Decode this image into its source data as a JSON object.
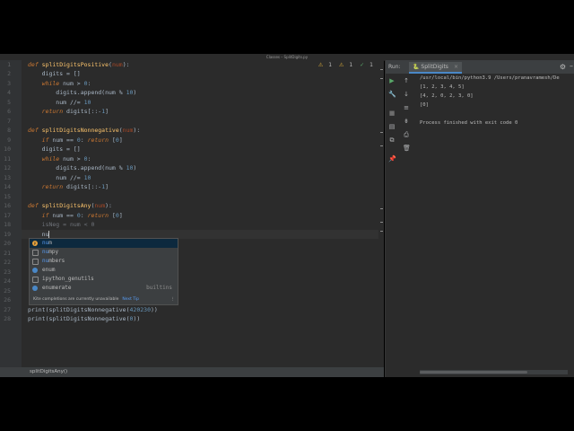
{
  "window": {
    "title": "Classes – SplitDigits.py"
  },
  "editor": {
    "inspections": {
      "warnings": "1",
      "weak_warnings": "1",
      "ok": "1"
    },
    "lines": [
      {
        "n": "1"
      },
      {
        "n": "2"
      },
      {
        "n": "3"
      },
      {
        "n": "4"
      },
      {
        "n": "5"
      },
      {
        "n": "6"
      },
      {
        "n": "7"
      },
      {
        "n": "8"
      },
      {
        "n": "9"
      },
      {
        "n": "10"
      },
      {
        "n": "11"
      },
      {
        "n": "12"
      },
      {
        "n": "13"
      },
      {
        "n": "14"
      },
      {
        "n": "15"
      },
      {
        "n": "16"
      },
      {
        "n": "17"
      },
      {
        "n": "18"
      },
      {
        "n": "19"
      },
      {
        "n": "20"
      },
      {
        "n": "21"
      },
      {
        "n": "22"
      },
      {
        "n": "23"
      },
      {
        "n": "24"
      },
      {
        "n": "25"
      },
      {
        "n": "26"
      },
      {
        "n": "27"
      },
      {
        "n": "28"
      }
    ],
    "code": {
      "l1_def": "def ",
      "l1_fn": "splitDigitsPositive",
      "l1_p1": "(",
      "l1_param": "num",
      "l1_p2": "):",
      "l2": "    digits = []",
      "l3_kw": "    while ",
      "l3_a": "num > ",
      "l3_num": "0",
      "l3_b": ":",
      "l4_a": "        digits.append(num % ",
      "l4_num": "10",
      "l4_b": ")",
      "l5_a": "        num //= ",
      "l5_num": "10",
      "l6_kw": "    return ",
      "l6_a": "digits[::-",
      "l6_num": "1",
      "l6_b": "]",
      "l8_def": "def ",
      "l8_fn": "splitDigitsNonnegative",
      "l8_p1": "(",
      "l8_param": "num",
      "l8_p2": "):",
      "l9_kw": "    if ",
      "l9_a": "num == ",
      "l9_num": "0",
      "l9_b": ": ",
      "l9_kw2": "return ",
      "l9_c": "[",
      "l9_num2": "0",
      "l9_d": "]",
      "l10": "    digits = []",
      "l11_kw": "    while ",
      "l11_a": "num > ",
      "l11_num": "0",
      "l11_b": ":",
      "l12_a": "        digits.append(num % ",
      "l12_num": "10",
      "l12_b": ")",
      "l13_a": "        num //= ",
      "l13_num": "10",
      "l14_kw": "    return ",
      "l14_a": "digits[::-",
      "l14_num": "1",
      "l14_b": "]",
      "l16_def": "def ",
      "l16_fn": "splitDigitsAny",
      "l16_p1": "(",
      "l16_param": "num",
      "l16_p2": "):",
      "l17_kw": "    if ",
      "l17_a": "num == ",
      "l17_num": "0",
      "l17_b": ": ",
      "l17_kw2": "return ",
      "l17_c": "[",
      "l17_num2": "0",
      "l17_d": "]",
      "l18_a": "    isNeg = num < ",
      "l18_num": "0",
      "l19": "    nu",
      "l27_a": "print(splitDigitsNonnegative(",
      "l27_num": "420230",
      "l27_b": "))",
      "l28_a": "print(splitDigitsNonnegative(",
      "l28_num": "0",
      "l28_b": "))"
    }
  },
  "completion": {
    "items": [
      {
        "match": "nu",
        "rest": "m",
        "icon": "p",
        "right": ""
      },
      {
        "match": "nu",
        "rest": "mpy",
        "icon": "",
        "right": ""
      },
      {
        "match": "nu",
        "rest": "mbers",
        "icon": "",
        "right": ""
      },
      {
        "match": "",
        "rest": "enum",
        "icon": "",
        "right": ""
      },
      {
        "match": "",
        "rest": "ipython_genutils",
        "icon": "",
        "right": ""
      },
      {
        "match": "",
        "rest": "enumerate",
        "icon": "",
        "right": "builtins"
      }
    ],
    "footer_text": "Kite completions are currently unavailable",
    "footer_link": "Next Tip"
  },
  "breadcrumb": {
    "text": "splitDigitsAny()"
  },
  "run_panel": {
    "label": "Run:",
    "tab": "SplitDigits",
    "output": [
      "/usr/local/bin/python3.9 /Users/pranavramesh/De",
      "[1, 2, 3, 4, 5]",
      "[4, 2, 0, 2, 3, 0]",
      "[0]",
      "",
      "Process finished with exit code 0"
    ]
  }
}
